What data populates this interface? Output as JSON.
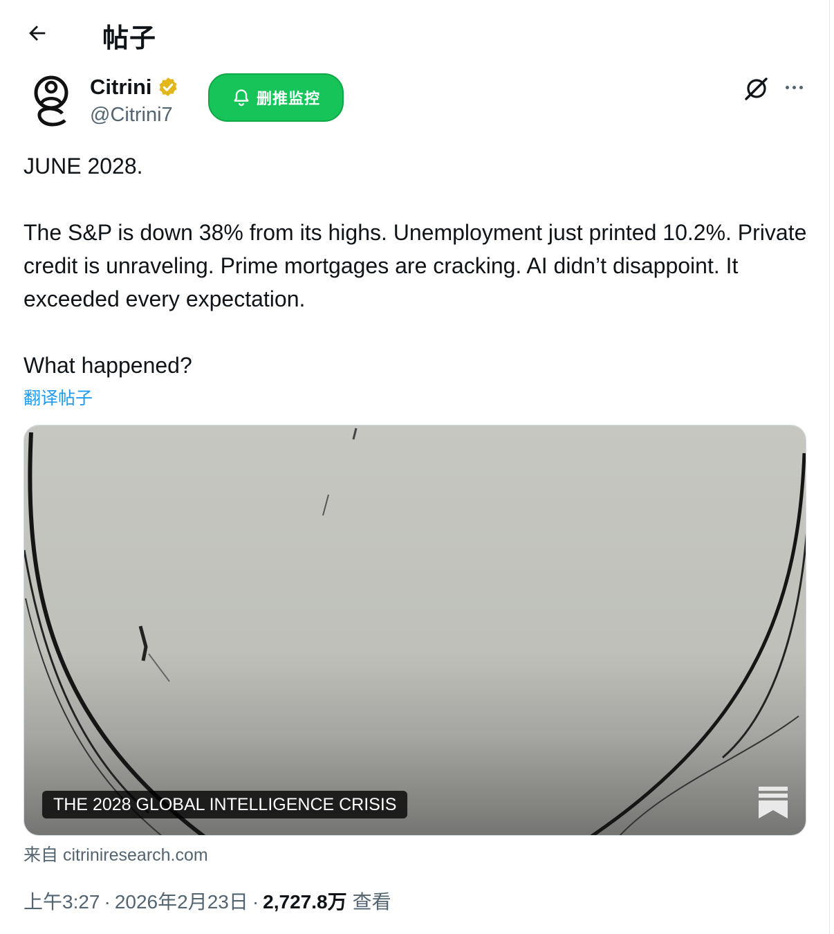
{
  "header": {
    "title": "帖子"
  },
  "author": {
    "name": "Citrini",
    "handle": "@Citrini7",
    "verified": true
  },
  "monitor_button": {
    "label": "删推监控"
  },
  "tweet": {
    "line1": "JUNE 2028.",
    "para2": "The S&P is down 38% from its highs. Unemployment just printed 10.2%. Private credit is unraveling. Prime mortgages are cracking. AI didn’t disappoint. It exceeded every expectation.",
    "para3": "What happened?"
  },
  "translate_link": "翻译帖子",
  "card": {
    "caption": "THE 2028 GLOBAL INTELLIGENCE CRISIS"
  },
  "source": "来自 citriniresearch.com",
  "meta": {
    "time": "上午3:27",
    "separator": "·",
    "date": "2026年2月23日",
    "views": "2,727.8万",
    "views_label": "查看"
  },
  "colors": {
    "accent_blue": "#1d9bf0",
    "verified_gold": "#e2b719",
    "monitor_green": "#16c45a",
    "secondary_text": "#536471"
  },
  "icons": [
    "back-arrow-icon",
    "verified-badge-icon",
    "bell-icon",
    "grok-icon",
    "more-icon",
    "substack-bookmark-icon"
  ]
}
